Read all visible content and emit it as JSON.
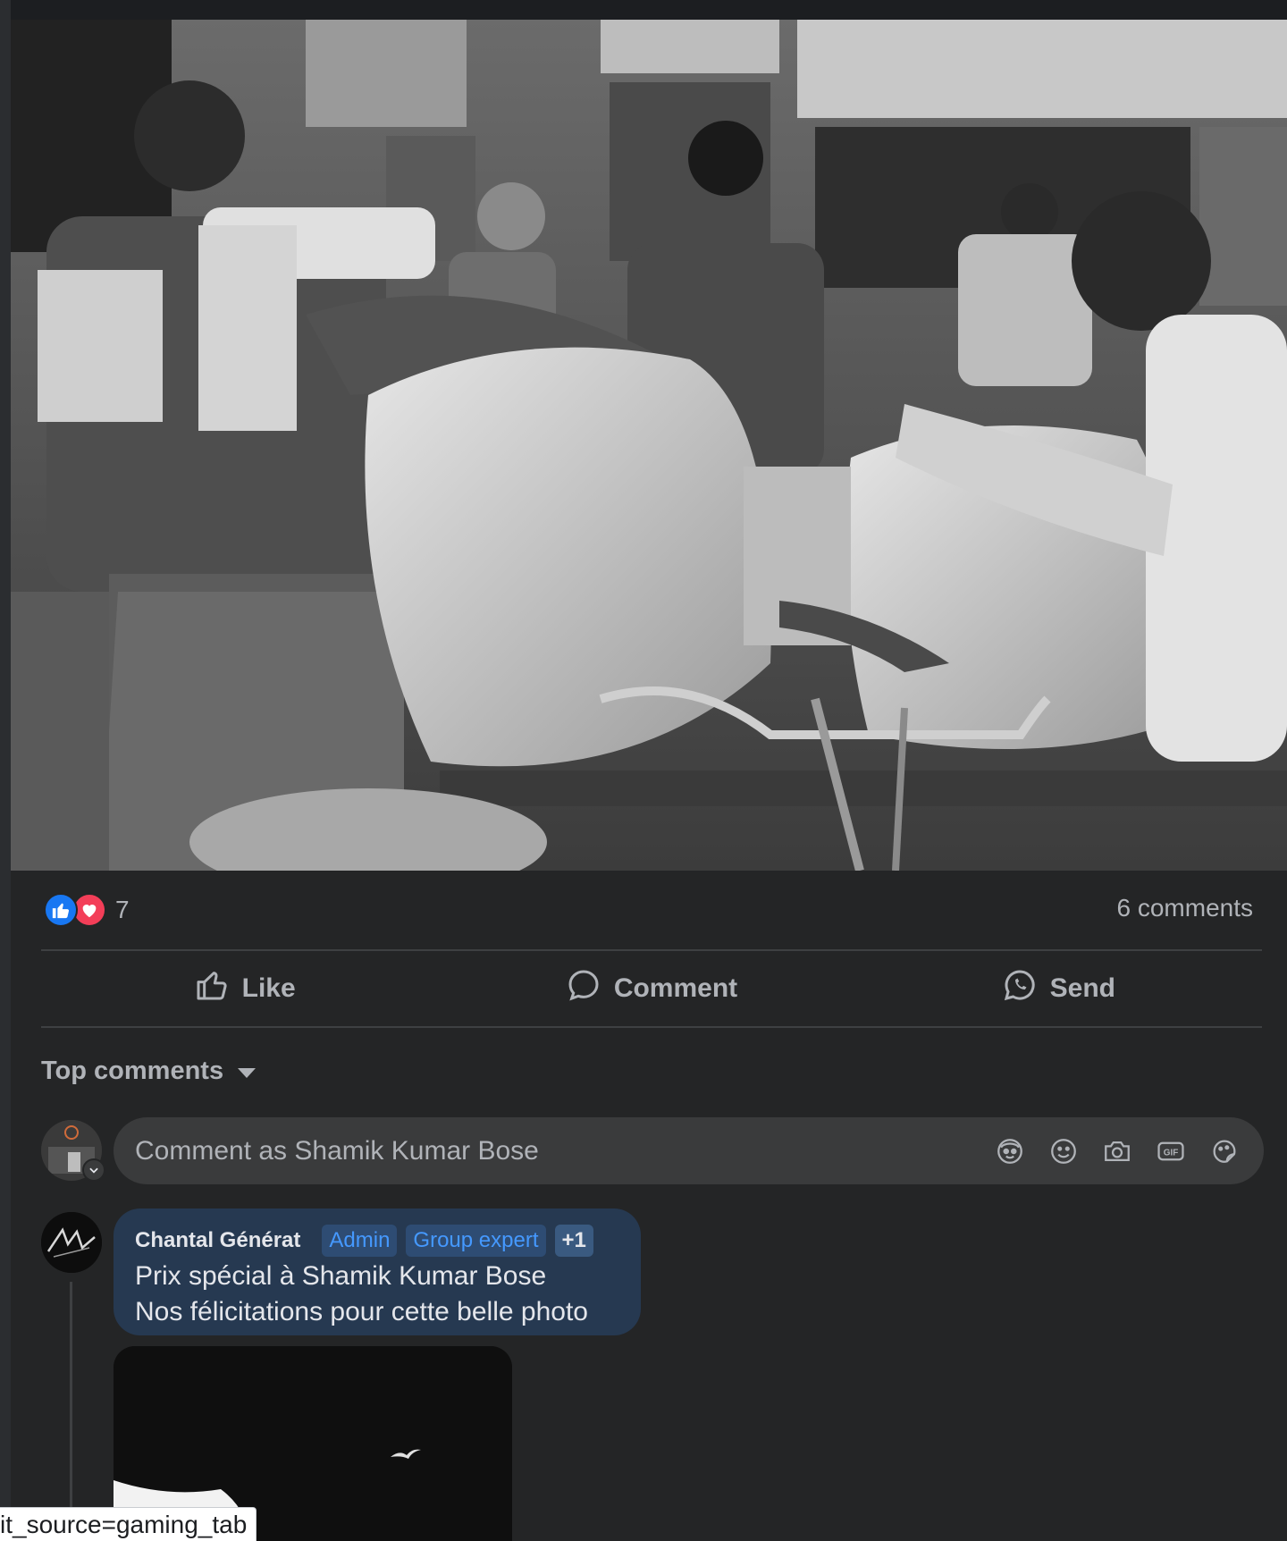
{
  "post": {
    "photo_alt": "Black and white street market photo",
    "reactions": {
      "count": "7",
      "types": [
        "like-icon",
        "love-icon"
      ],
      "like_color": "#1877f2",
      "love_color": "#f33e58"
    },
    "comments_count": "6 comments",
    "actions": {
      "like": "Like",
      "comment": "Comment",
      "send": "Send"
    }
  },
  "comments_section": {
    "sort_label": "Top comments",
    "input_placeholder": "Comment as Shamik Kumar Bose",
    "input_icons": [
      "avatar-sticker-icon",
      "emoji-icon",
      "camera-icon",
      "gif-icon",
      "sticker-icon"
    ],
    "comments": [
      {
        "author": "Chantal Générat",
        "badges": [
          "Admin",
          "Group expert",
          "+1"
        ],
        "lines": [
          "Prix spécial à Shamik Kumar Bose",
          "Nos félicitations pour cette belle photo"
        ]
      }
    ]
  },
  "status_bar": {
    "url_fragment": "it_source=gaming_tab"
  },
  "colors": {
    "background": "#18191a",
    "card": "#242526",
    "bubble": "#263951",
    "badge_text": "#4599ff"
  }
}
